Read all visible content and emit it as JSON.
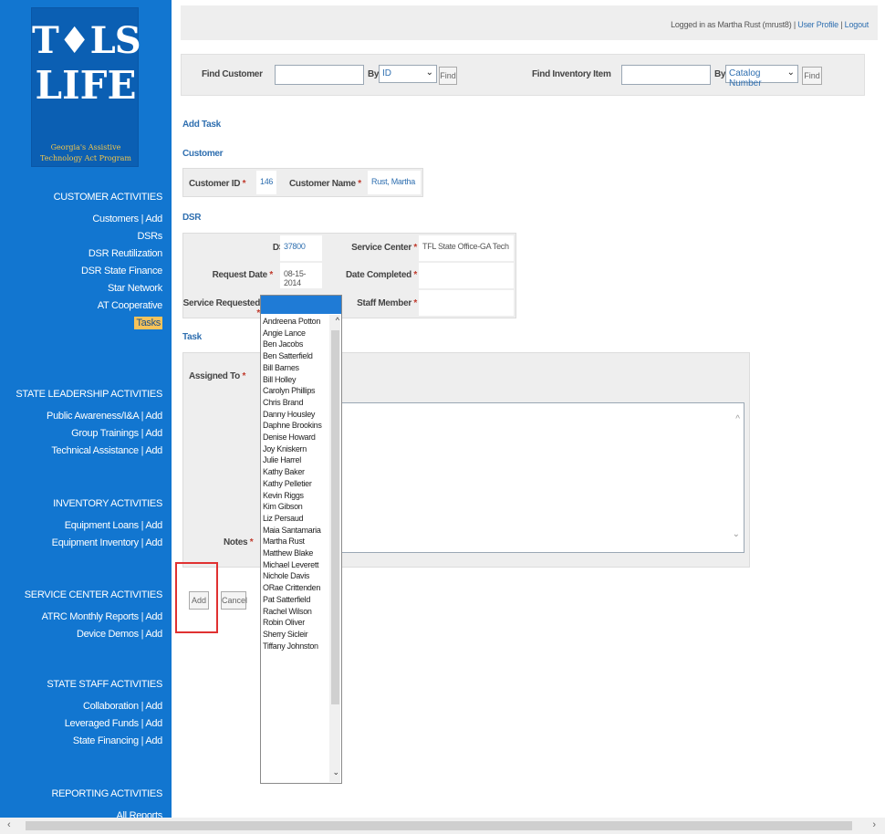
{
  "logo": {
    "line1": "T♦LS",
    "line2": "LIFE",
    "tagline1": "Georgia's Assistive",
    "tagline2": "Technology Act Program"
  },
  "sidebar": {
    "groups": [
      {
        "heading": "CUSTOMER ACTIVITIES",
        "items": [
          "Customers | Add",
          "DSRs",
          "DSR Reutilization",
          "DSR State Finance",
          "Star Network",
          "AT Cooperative",
          "Tasks"
        ]
      },
      {
        "heading": "STATE LEADERSHIP ACTIVITIES",
        "items": [
          "Public Awareness/I&A | Add",
          "Group Trainings | Add",
          "Technical Assistance | Add"
        ]
      },
      {
        "heading": "INVENTORY ACTIVITIES",
        "items": [
          "Equipment Loans | Add",
          "Equipment Inventory | Add"
        ]
      },
      {
        "heading": "SERVICE CENTER ACTIVITIES",
        "items": [
          "ATRC Monthly Reports | Add",
          "Device Demos | Add"
        ]
      },
      {
        "heading": "STATE STAFF ACTIVITIES",
        "items": [
          "Collaboration | Add",
          "Leveraged Funds | Add",
          "State Financing | Add"
        ]
      },
      {
        "heading": "REPORTING ACTIVITIES",
        "items": [
          "All Reports"
        ]
      }
    ],
    "active_item": "Tasks"
  },
  "topbar": {
    "logged_in": "Logged in as Martha Rust (mrust8) |",
    "user_profile": "User Profile",
    "sep": "|",
    "logout": "Logout"
  },
  "find": {
    "customer_label": "Find Customer",
    "by_label": "By",
    "customer_by_value": "ID",
    "find_button": "Find",
    "inventory_label": "Find Inventory Item",
    "inventory_by_value": "Catalog Number"
  },
  "page": {
    "add_task": "Add Task",
    "customer_section": "Customer",
    "dsr_section": "DSR",
    "task_section": "Task"
  },
  "customer": {
    "id_label": "Customer ID",
    "id_value": "146",
    "name_label": "Customer Name",
    "name_value": "Rust, Martha"
  },
  "dsr": {
    "id_label": "DSR ID",
    "id_value": "37800",
    "center_label": "Service Center",
    "center_value": "TFL State Office-GA Tech",
    "request_label": "Request Date",
    "request_value": "08-15-2014",
    "completed_label": "Date Completed",
    "completed_value": "",
    "service_label": "Service Requested",
    "staff_label": "Staff Member"
  },
  "task": {
    "assigned_label": "Assigned To",
    "notes_label": "Notes",
    "add_button": "Add",
    "cancel_button": "Cancel"
  },
  "required_mark": "*",
  "dropdown": {
    "options": [
      "Andreena Potton",
      "Angie Lance",
      "Ben Jacobs",
      "Ben Satterfield",
      "Bill Barnes",
      "Bill Holley",
      "Carolyn Phillips",
      "Chris Brand",
      "Danny Housley",
      "Daphne Brookins",
      "Denise Howard",
      "Joy Kniskern",
      "Julie Harrel",
      "Kathy Baker",
      "Kathy Pelletier",
      "Kevin Riggs",
      "Kim Gibson",
      "Liz Persaud",
      "Maia Santamaria",
      "Martha Rust",
      "Matthew Blake",
      "Michael Leverett",
      "Nichole Davis",
      "ORae Crittenden",
      "Pat Satterfield",
      "Rachel Wilson",
      "Robin Oliver",
      "Sherry Sicleir",
      "Tiffany Johnston"
    ]
  },
  "colors": {
    "sidebar": "#1276d0",
    "active": "#f7c35a",
    "link": "#2f6fb0",
    "required": "#c0392b",
    "highlight": "#e03131"
  }
}
